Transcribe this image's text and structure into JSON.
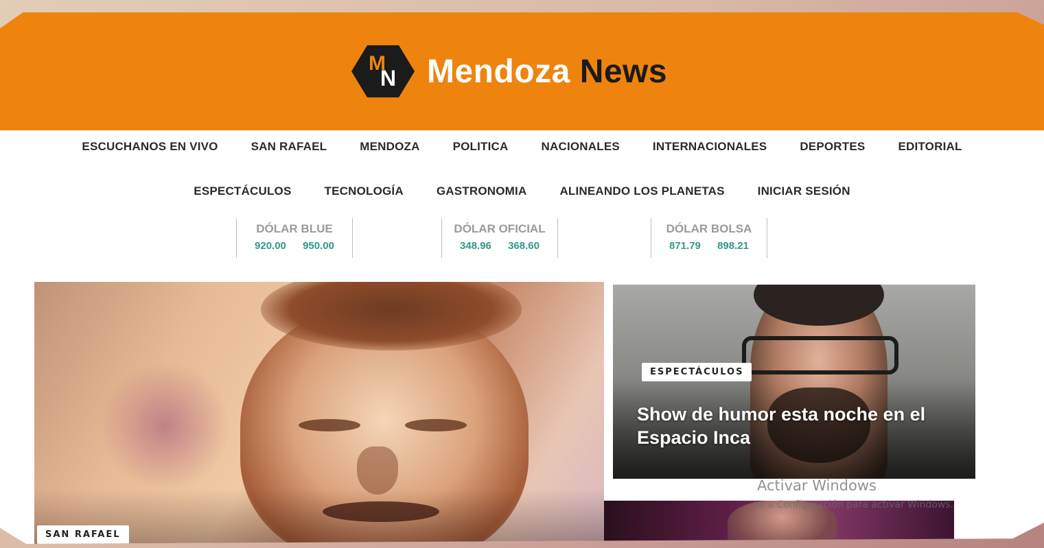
{
  "brand": {
    "logo_mark_top": "M",
    "logo_mark_bottom": "N",
    "name_part1": "Mendoza",
    "name_part2": "News",
    "colors": {
      "header_bg": "#ee840e",
      "dark": "#1b1b1b",
      "value_green": "#2e9a8a"
    }
  },
  "nav": {
    "row1": [
      "ESCUCHANOS EN VIVO",
      "SAN RAFAEL",
      "MENDOZA",
      "POLITICA",
      "NACIONALES",
      "INTERNACIONALES",
      "DEPORTES",
      "EDITORIAL"
    ],
    "row2": [
      "ESPECTÁCULOS",
      "TECNOLOGÍA",
      "GASTRONOMIA",
      "ALINEANDO LOS PLANETAS",
      "INICIAR SESIÓN"
    ]
  },
  "exchange": [
    {
      "label": "DÓLAR BLUE",
      "buy": "920.00",
      "sell": "950.00"
    },
    {
      "label": "DÓLAR OFICIAL",
      "buy": "348.96",
      "sell": "368.60"
    },
    {
      "label": "DÓLAR BOLSA",
      "buy": "871.79",
      "sell": "898.21"
    }
  ],
  "featured": {
    "category": "SAN RAFAEL"
  },
  "side_story_1": {
    "category": "ESPECTÁCULOS",
    "title": "Show de humor esta noche en el Espacio Inca"
  },
  "watermark": {
    "title": "Activar Windows",
    "subtitle": "Ve a Configuración para activar Windows."
  }
}
